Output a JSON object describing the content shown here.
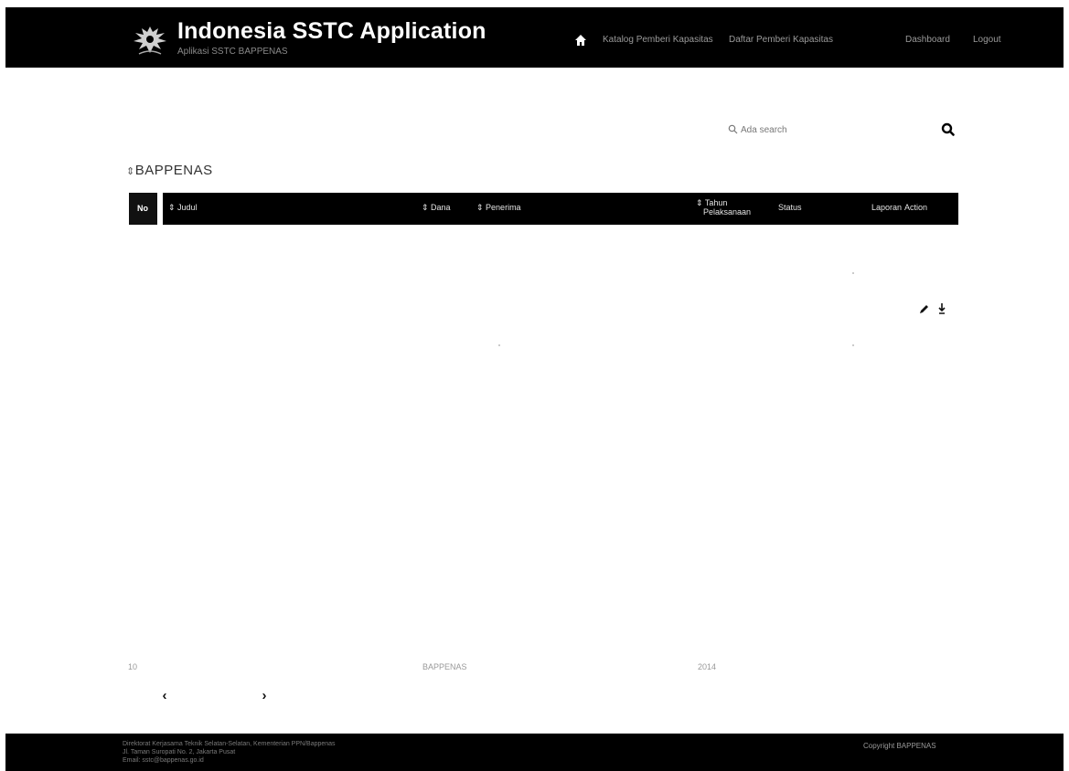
{
  "header": {
    "title": "Indonesia SSTC Application",
    "subtitle": "Aplikasi SSTC BAPPENAS",
    "nav": {
      "home_icon": "home-icon",
      "katalog": "Katalog Pemberi Kapasitas",
      "daftar": "Daftar Pemberi Kapasitas",
      "dashboard": "Dashboard",
      "logout": "Logout"
    }
  },
  "search": {
    "placeholder": "Ada search",
    "icon": "search-icon"
  },
  "page": {
    "title": "BAPPENAS"
  },
  "table": {
    "headers": {
      "no": "No",
      "judul": "Judul",
      "dana": "Dana",
      "penerima": "Penerima",
      "tahun_line1": "Tahun",
      "tahun_line2": "Pelaksanaan",
      "status": "Status",
      "laporan": "Laporan",
      "action": "Action"
    },
    "row_actions": [
      "edit-icon",
      "download-icon"
    ]
  },
  "pagination": {
    "count": "10",
    "source": "BAPPENAS",
    "year": "2014",
    "prev": "‹",
    "next": "›"
  },
  "footer": {
    "line1": "Direktorat Kerjasama Teknik Selatan-Selatan, Kementerian PPN/Bappenas",
    "line2": "Jl. Taman Suropati No. 2, Jakarta Pusat",
    "line3": "Email: sstc@bappenas.go.id",
    "right": "Copyright BAPPENAS"
  },
  "colors": {
    "bar": "#000000",
    "background": "#ffffff"
  }
}
